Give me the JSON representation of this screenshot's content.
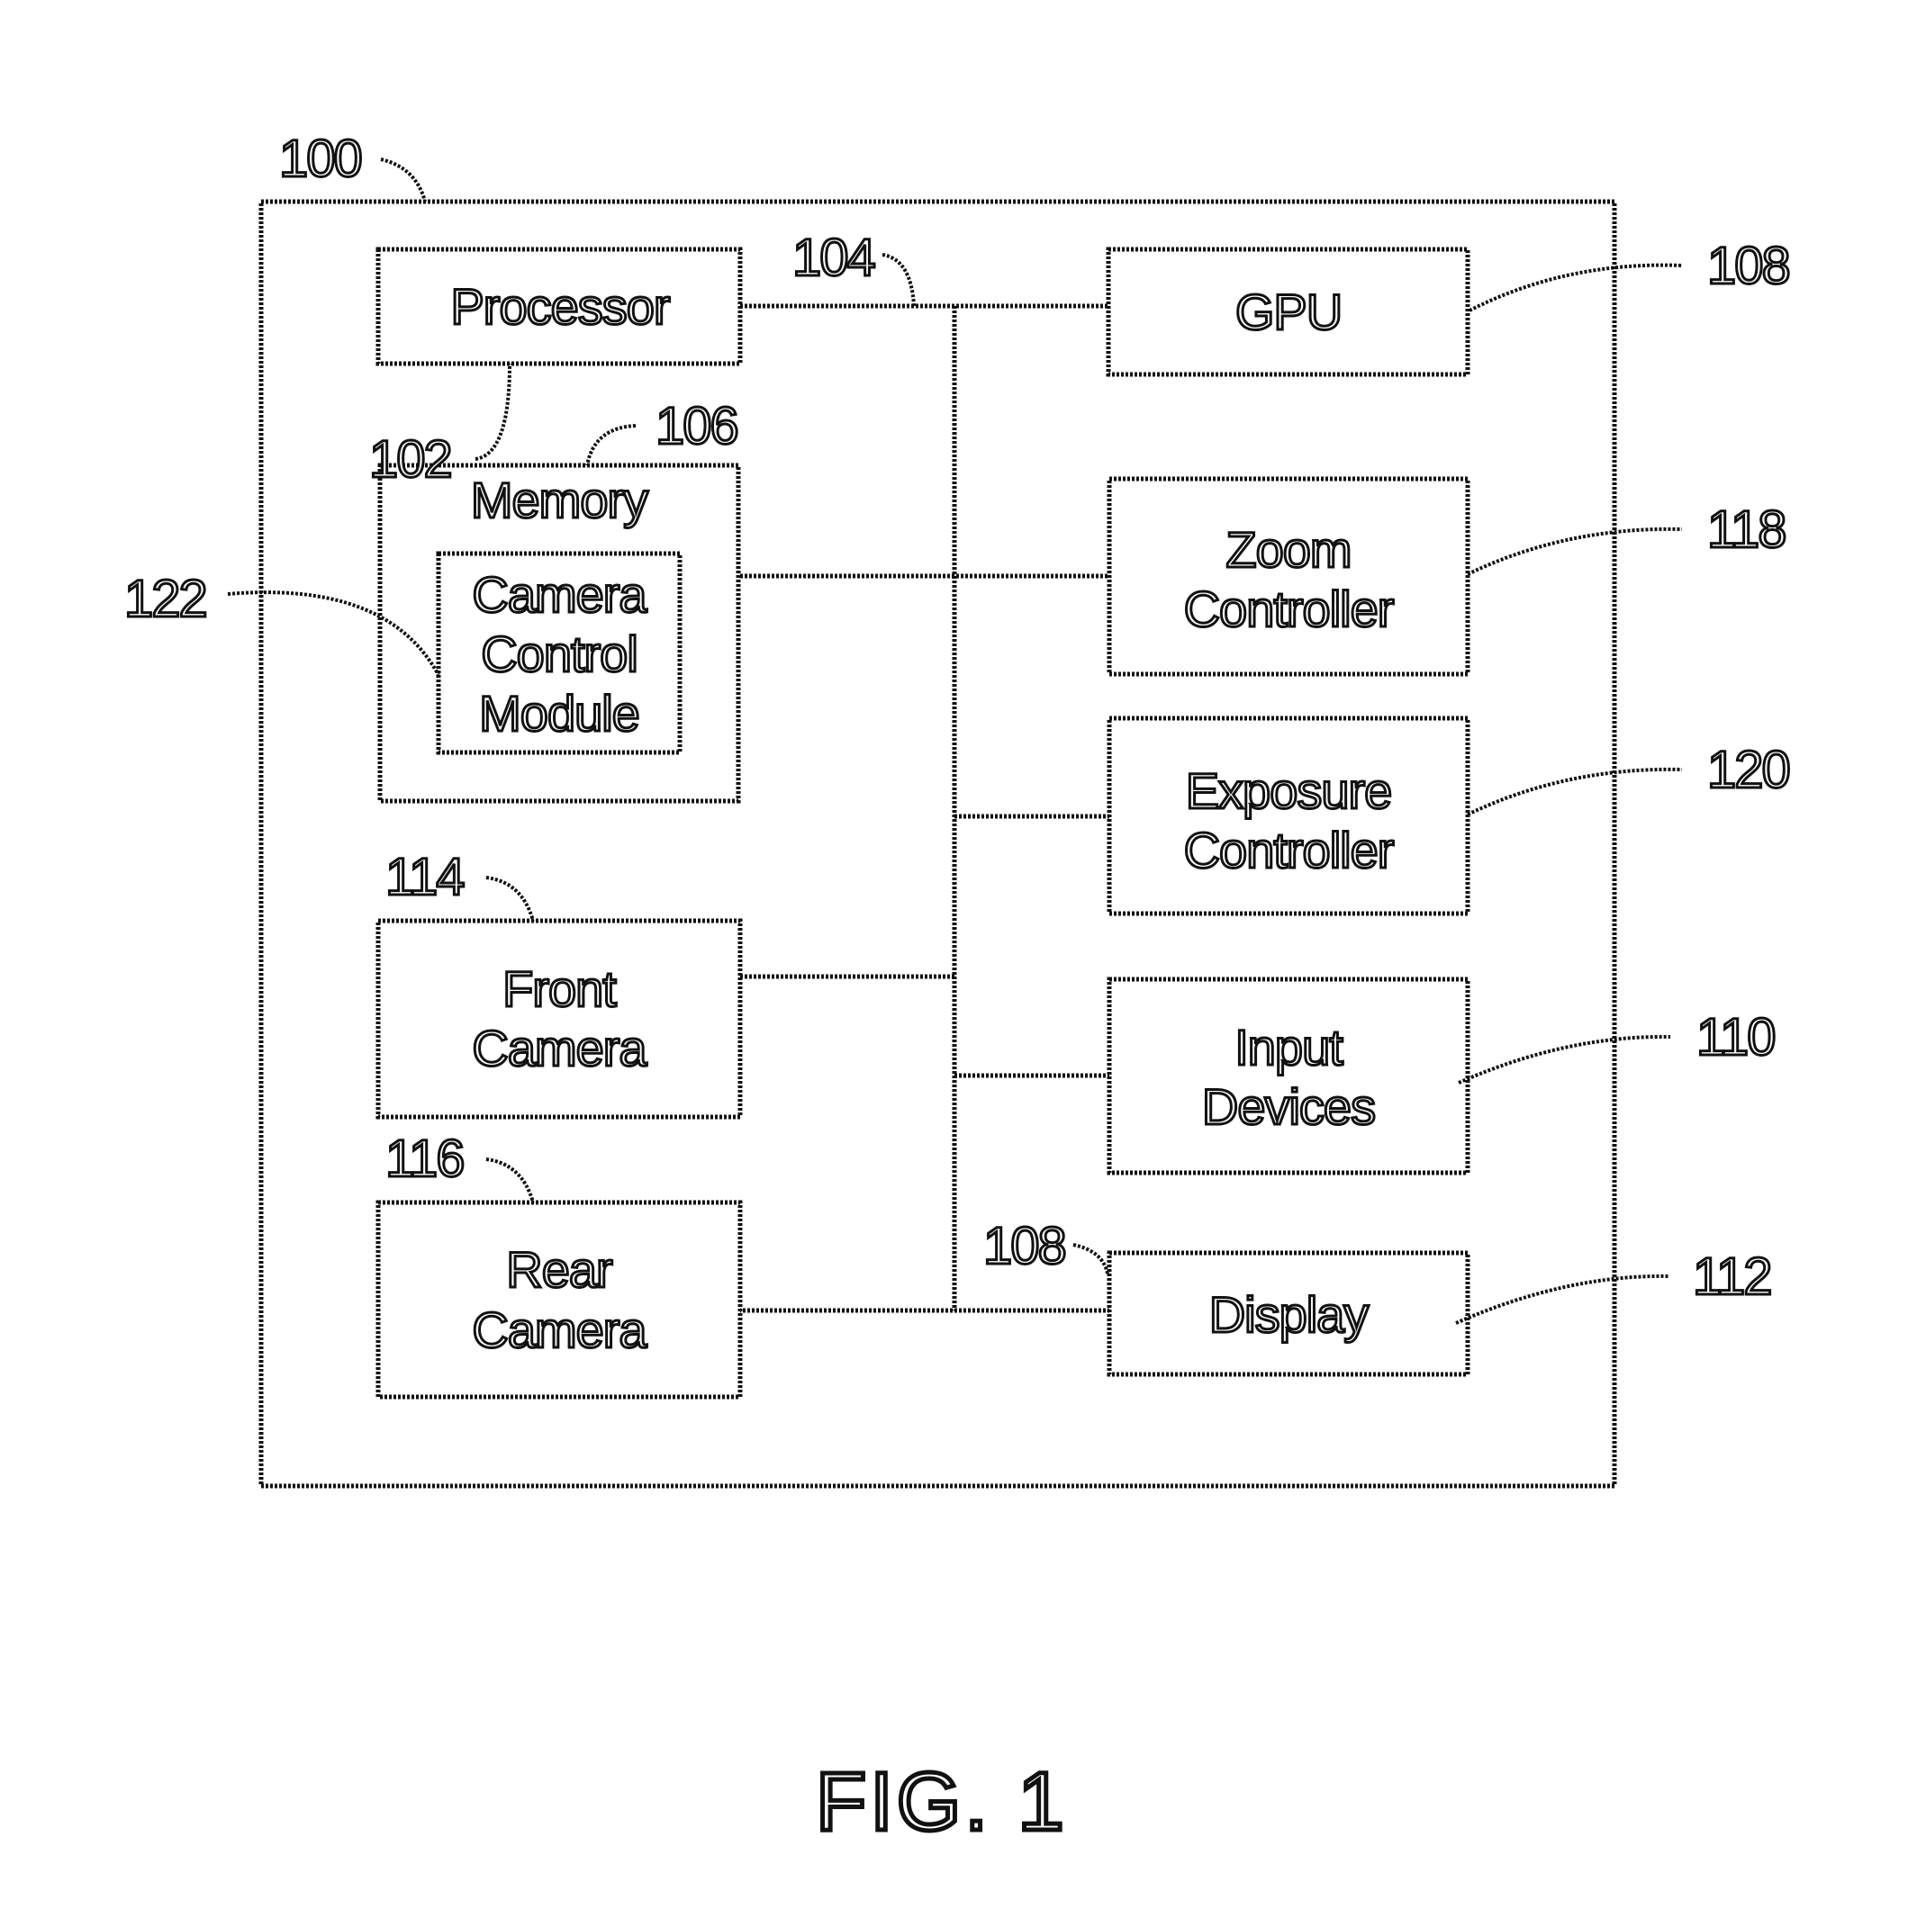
{
  "figure": {
    "caption": "FIG. 1",
    "device_ref": "100"
  },
  "blocks": {
    "processor": {
      "lines": [
        "Processor"
      ],
      "ref": "102"
    },
    "bus": {
      "ref": "104"
    },
    "memory": {
      "lines": [
        "Memory"
      ],
      "ref": "106"
    },
    "camera_control_module": {
      "lines": [
        "Camera",
        "Control",
        "Module"
      ],
      "ref": "122"
    },
    "gpu": {
      "lines": [
        "GPU"
      ],
      "ref": "108"
    },
    "zoom_controller": {
      "lines": [
        "Zoom",
        "Controller"
      ],
      "ref": "118"
    },
    "exposure_controller": {
      "lines": [
        "Exposure",
        "Controller"
      ],
      "ref": "120"
    },
    "front_camera": {
      "lines": [
        "Front",
        "Camera"
      ],
      "ref": "114"
    },
    "input_devices": {
      "lines": [
        "Input",
        "Devices"
      ],
      "ref": "110"
    },
    "rear_camera": {
      "lines": [
        "Rear",
        "Camera"
      ],
      "ref": "116"
    },
    "display": {
      "lines": [
        "Display"
      ],
      "ref": "112",
      "secondary_ref": "108"
    }
  }
}
